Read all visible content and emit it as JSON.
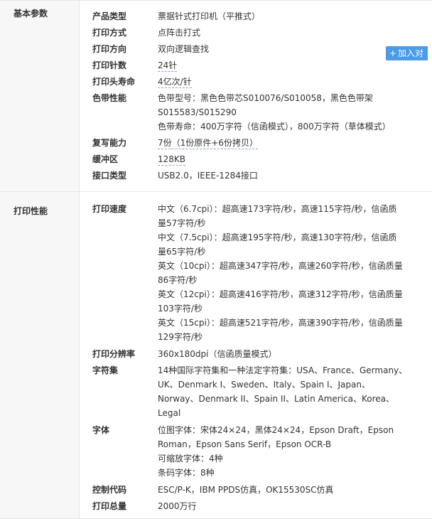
{
  "add_button": {
    "plus": "+",
    "label": "加入对"
  },
  "sections": [
    {
      "title": "基本参数",
      "rows": [
        {
          "label": "产品类型",
          "lines": [
            "票据针式打印机（平推式）"
          ]
        },
        {
          "label": "打印方式",
          "lines": [
            "点阵击打式"
          ]
        },
        {
          "label": "打印方向",
          "lines": [
            "双向逻辑查找"
          ]
        },
        {
          "label": "打印针数",
          "lines": [
            "24针"
          ]
        },
        {
          "label": "打印头寿命",
          "lines": [
            "4亿次/针"
          ]
        },
        {
          "label": "色带性能",
          "lines": [
            "色带型号：黑色色带芯S010076/S010058，黑色色带架",
            "S015583/S015290",
            "色带寿命：400万字符（信函模式），800万字符（草体模式）"
          ]
        },
        {
          "label": "复写能力",
          "lines": [
            "7份（1份原件+6份拷贝）"
          ]
        },
        {
          "label": "缓冲区",
          "lines": [
            "128KB"
          ]
        },
        {
          "label": "接口类型",
          "lines": [
            "USB2.0，IEEE-1284接口"
          ]
        }
      ]
    },
    {
      "title": "打印性能",
      "rows": [
        {
          "label": "打印速度",
          "lines": [
            "中文（6.7cpi）：超高速173字符/秒，高速115字符/秒，信函质",
            "量57字符/秒",
            "中文（7.5cpi）：超高速195字符/秒，高速130字符/秒，信函质",
            "量65字符/秒",
            "英文（10cpi）：超高速347字符/秒，高速260字符/秒，信函质量",
            "86字符/秒",
            "英文（12cpi）：超高速416字符/秒，高速312字符/秒，信函质量",
            "103字符/秒",
            "英文（15cpi）：超高速521字符/秒，高速390字符/秒，信函质量",
            "129字符/秒"
          ]
        },
        {
          "label": "打印分辨率",
          "lines": [
            "360x180dpi（信函质量模式）"
          ]
        },
        {
          "label": "字符集",
          "lines": [
            "14种国际字符集和一种法定字符集：USA、France、Germany、",
            "UK、Denmark I、Sweden、Italy、Spain I、Japan、",
            "Norway、Denmark II、Spain II、Latin America、Korea、",
            "Legal"
          ]
        },
        {
          "label": "字体",
          "lines": [
            "位图字体：宋体24×24，黑体24×24，Epson Draft，Epson",
            "Roman，Epson Sans Serif，Epson OCR-B",
            "可缩放字体：4种",
            "条码字体：8种"
          ]
        },
        {
          "label": "控制代码",
          "lines": [
            "ESC/P-K，IBM PPDS仿真，OK15530SC仿真"
          ]
        },
        {
          "label": "打印总量",
          "lines": [
            "2000万行"
          ]
        }
      ]
    }
  ]
}
